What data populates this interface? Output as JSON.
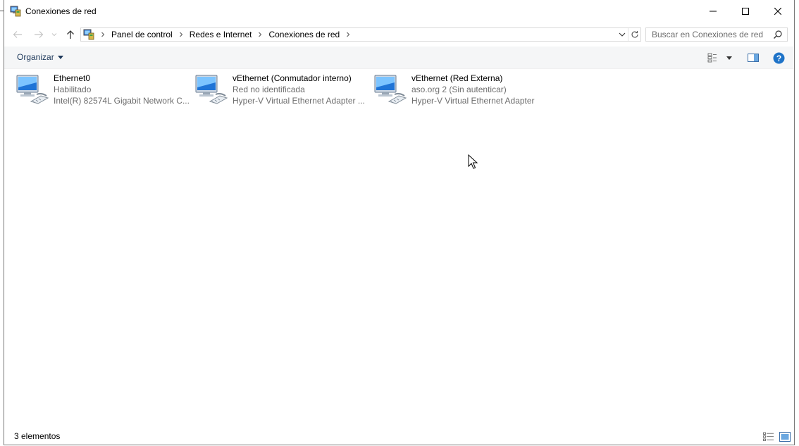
{
  "window": {
    "title": "Conexiones de red",
    "controls": {
      "minimize": "minimize-icon",
      "maximize": "maximize-icon",
      "close": "close-icon"
    }
  },
  "nav": {
    "breadcrumbs": [
      "Panel de control",
      "Redes e Internet",
      "Conexiones de red"
    ],
    "search_placeholder": "Buscar en Conexiones de red"
  },
  "toolbar": {
    "organize_label": "Organizar"
  },
  "connections": [
    {
      "name": "Ethernet0",
      "status": "Habilitado",
      "device": "Intel(R) 82574L Gigabit Network C..."
    },
    {
      "name": "vEthernet (Conmutador interno)",
      "status": "Red no identificada",
      "device": "Hyper-V Virtual Ethernet Adapter ..."
    },
    {
      "name": "vEthernet (Red Externa)",
      "status": "aso.org 2 (Sin autenticar)",
      "device": "Hyper-V Virtual Ethernet Adapter"
    }
  ],
  "statusbar": {
    "count_text": "3 elementos"
  },
  "colors": {
    "help_blue": "#1e73c8",
    "command_bar_bg": "#f5f6f7",
    "secondary_text": "#6d6d6d"
  }
}
